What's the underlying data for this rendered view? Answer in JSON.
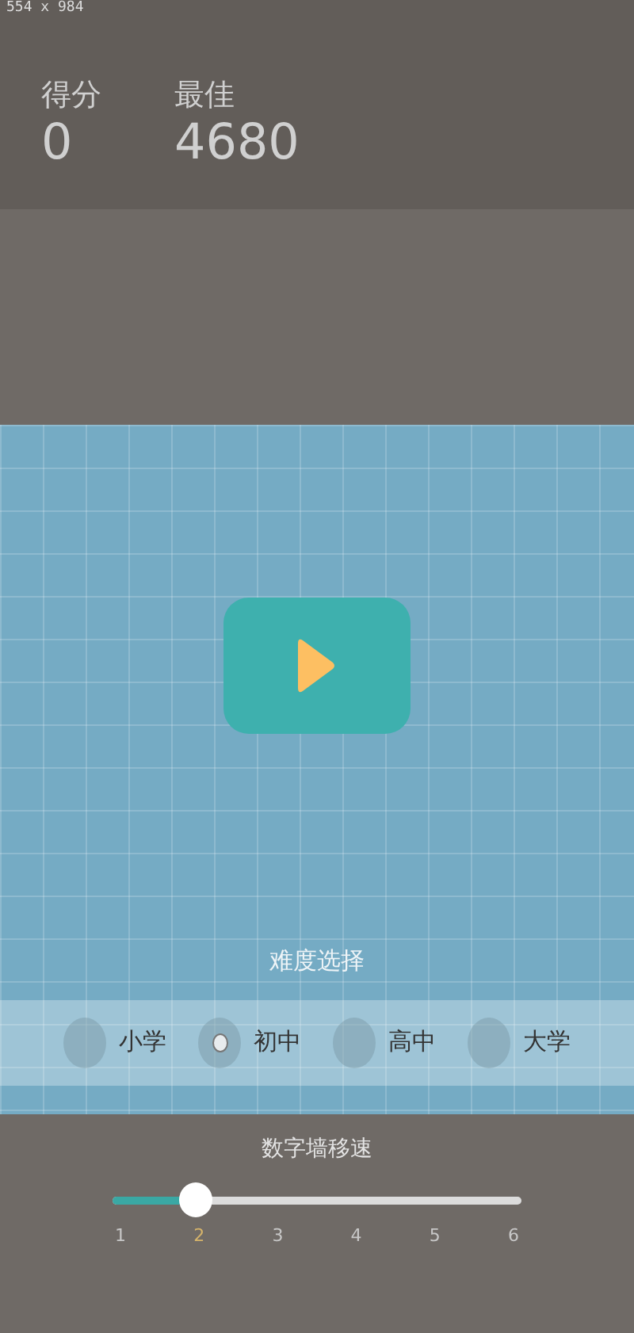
{
  "debug_label": "554 x 984",
  "scores": [
    {
      "label": "得分",
      "value": "0"
    },
    {
      "label": "最佳",
      "value": "4680"
    }
  ],
  "play_button": {
    "kind": "play"
  },
  "difficulty": {
    "title": "难度选择",
    "options": [
      {
        "label": "小学",
        "selected": false
      },
      {
        "label": "初中",
        "selected": true
      },
      {
        "label": "高中",
        "selected": false
      },
      {
        "label": "大学",
        "selected": false
      }
    ]
  },
  "speed": {
    "title": "数字墙移速",
    "level": 0.2,
    "ticks": [
      {
        "label": "1",
        "selected": false
      },
      {
        "label": "2",
        "selected": true
      },
      {
        "label": "3",
        "selected": false
      },
      {
        "label": "4",
        "selected": false
      },
      {
        "label": "5",
        "selected": false
      },
      {
        "label": "6",
        "selected": false
      }
    ]
  }
}
